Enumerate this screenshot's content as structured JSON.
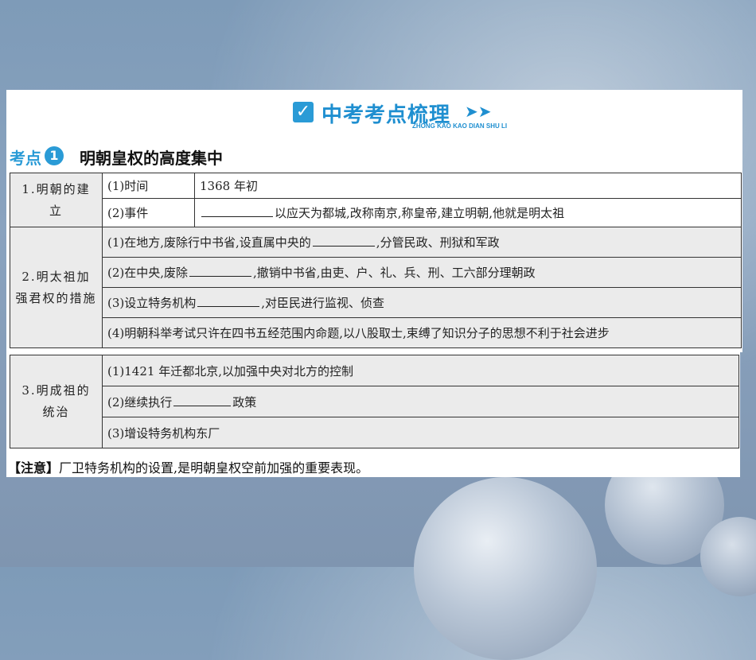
{
  "header": {
    "icon": "check-icon",
    "title": "中考考点梳理",
    "arrows": "➤➤",
    "pinyin": "ZHONG KAO KAO DIAN SHU LI"
  },
  "topic": {
    "tag": "考点",
    "number": "1",
    "title": "明朝皇权的高度集中"
  },
  "rows": {
    "s1": {
      "label": "1.明朝的建立",
      "r1_key": "(1)时间",
      "r1_val": "1368 年初",
      "r2_key": "(2)事件",
      "r2_val": "以应天为都城,改称南京,称皇帝,建立明朝,他就是明太祖"
    },
    "s2": {
      "label": "2.明太祖加强君权的措施",
      "r1_a": "(1)在地方,废除行中书省,设直属中央的",
      "r1_b": ",分管民政、刑狱和军政",
      "r2_a": "(2)在中央,废除",
      "r2_b": ",撤销中书省,由吏、户、礼、兵、刑、工六部分理朝政",
      "r3_a": "(3)设立特务机构",
      "r3_b": ",对臣民进行监视、侦查",
      "r4": "(4)明朝科举考试只许在四书五经范围内命题,以八股取士,束缚了知识分子的思想不利于社会进步"
    },
    "s3": {
      "label": "3.明成祖的统治",
      "r1": "(1)1421 年迁都北京,以加强中央对北方的控制",
      "r2_a": "(2)继续执行",
      "r2_b": "政策",
      "r3": "(3)增设特务机构东厂"
    }
  },
  "note": {
    "tag": "【注意】",
    "text": "厂卫特务机构的设置,是明朝皇权空前加强的重要表现。"
  }
}
